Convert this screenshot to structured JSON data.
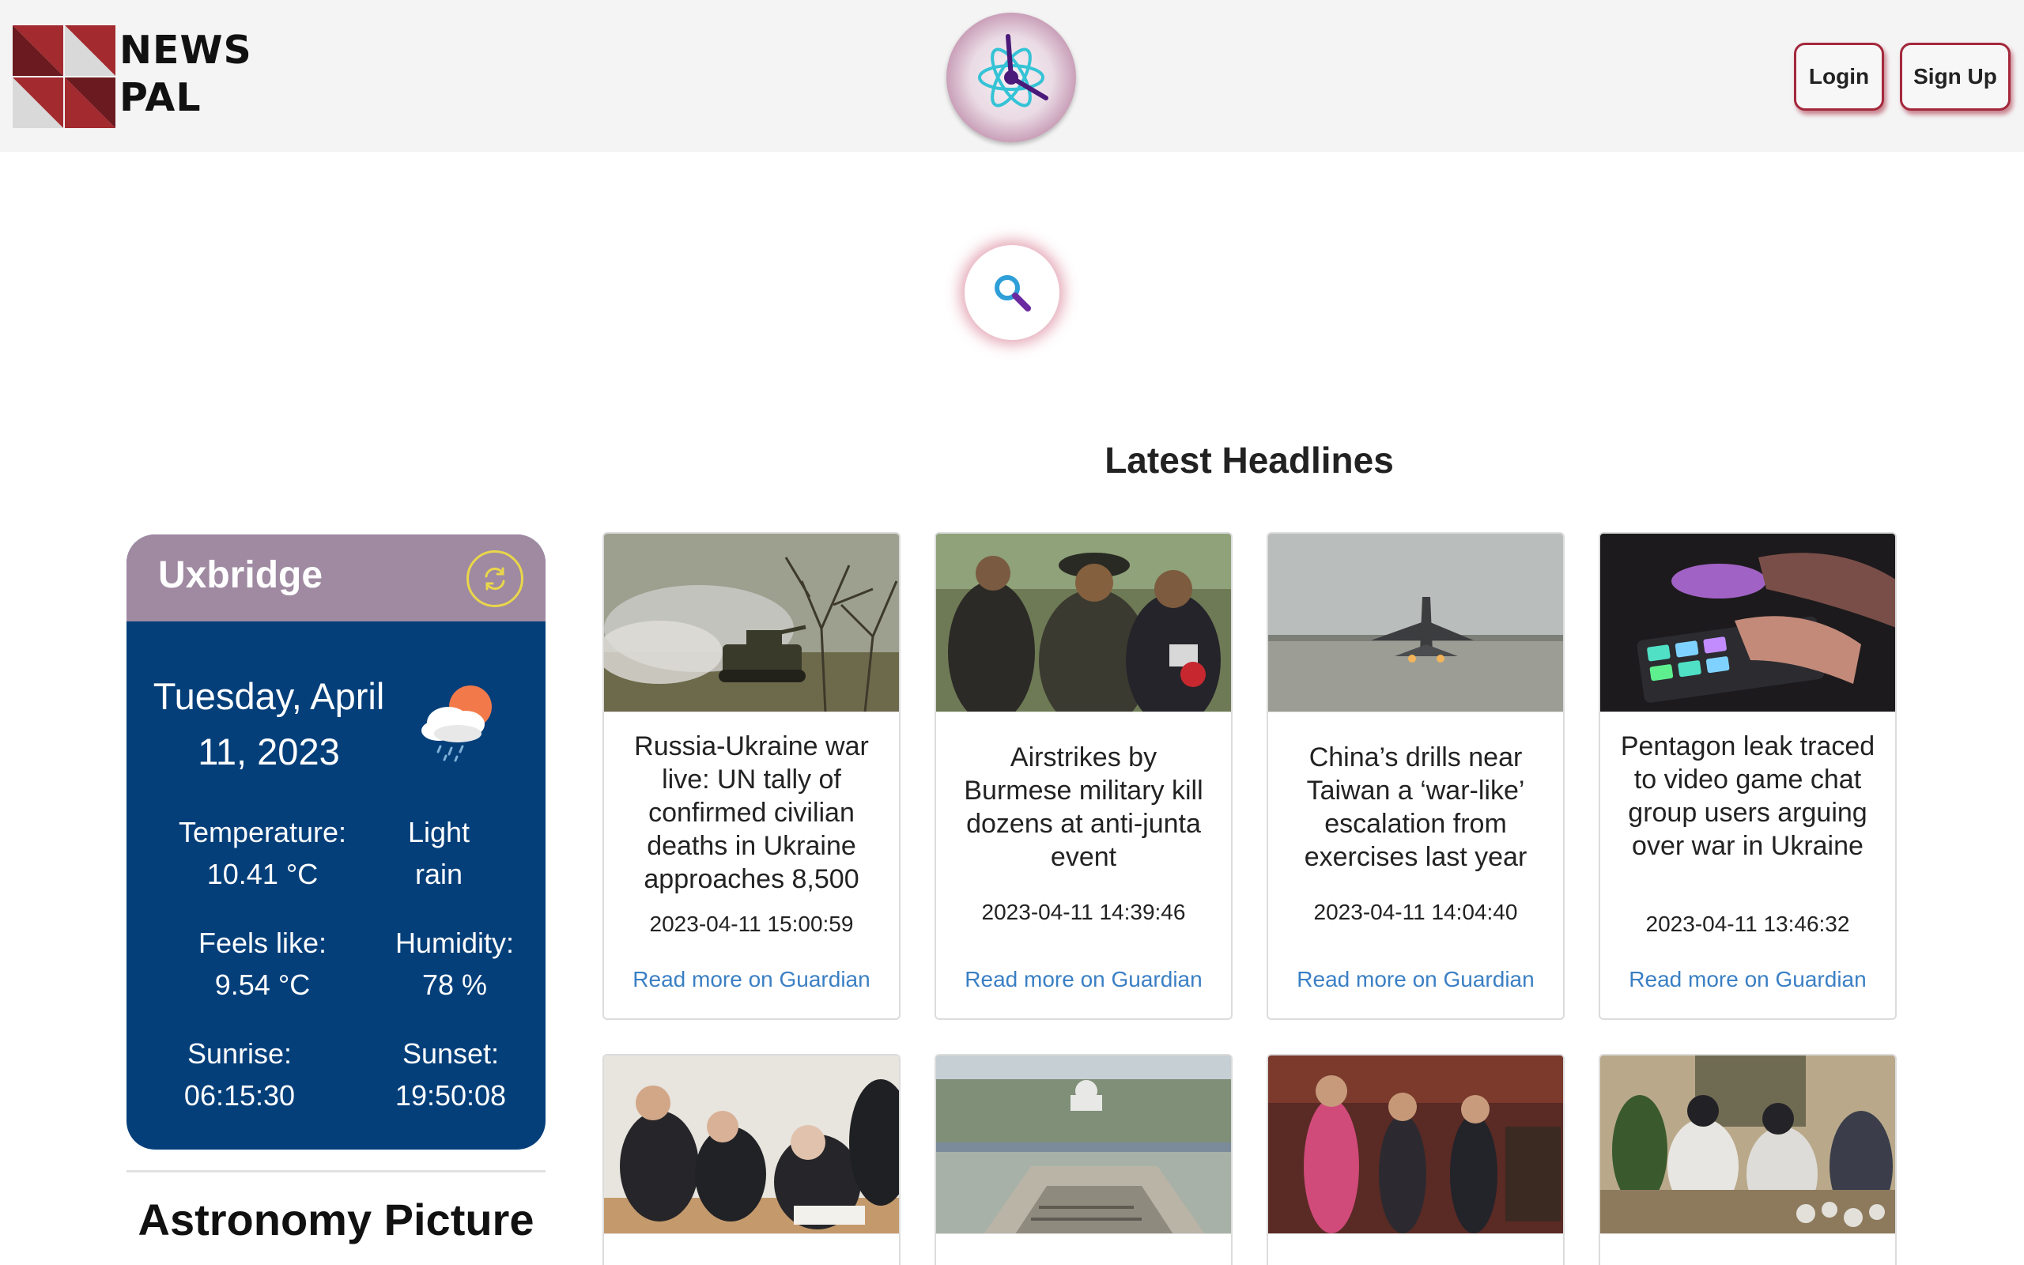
{
  "header": {
    "logo_line1": "NEWS",
    "logo_line2": "PAL",
    "login_label": "Login",
    "signup_label": "Sign Up"
  },
  "colors": {
    "brand_red": "#a4283c",
    "weather_blue": "#043f7a",
    "weather_header": "#9f8aa2",
    "link_blue": "#3a7fc4"
  },
  "search": {
    "icon": "search-icon"
  },
  "headlines": {
    "title": "Latest Headlines"
  },
  "weather": {
    "city": "Uxbridge",
    "date": "Tuesday, April 11, 2023",
    "condition_icon": "cloud-sun-rain-icon",
    "temperature_label": "Temperature:",
    "temperature_value": "10.41 °C",
    "description_line1": "Light",
    "description_line2": "rain",
    "feels_label": "Feels like:",
    "feels_value": "9.54 °C",
    "humidity_label": "Humidity:",
    "humidity_value": "78 %",
    "sunrise_label": "Sunrise:",
    "sunrise_value": "06:15:30",
    "sunset_label": "Sunset:",
    "sunset_value": "19:50:08"
  },
  "astronomy": {
    "title": "Astronomy Picture"
  },
  "articles": [
    {
      "title": "Russia-Ukraine war live: UN tally of confirmed civilian deaths in Ukraine approaches 8,500",
      "date": "2023-04-11 15:00:59",
      "link": "Read more on Guardian"
    },
    {
      "title": "Airstrikes by Burmese military kill dozens at anti-junta event",
      "date": "2023-04-11 14:39:46",
      "link": "Read more on Guardian"
    },
    {
      "title": "China’s drills near Taiwan a ‘war-like’ escalation from exercises last year",
      "date": "2023-04-11 14:04:40",
      "link": "Read more on Guardian"
    },
    {
      "title": "Pentagon leak traced to video game chat group users arguing over war in Ukraine",
      "date": "2023-04-11 13:46:32",
      "link": "Read more on Guardian"
    }
  ]
}
